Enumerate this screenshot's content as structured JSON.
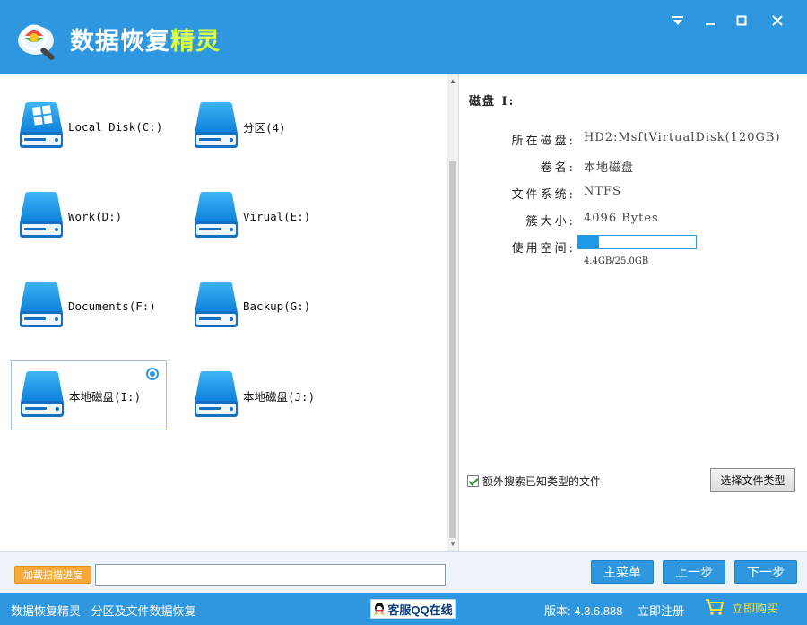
{
  "app": {
    "title_prefix": "数据恢复",
    "title_highlight": "精灵"
  },
  "window_controls": {
    "menu_icon": "menu-down-icon",
    "minimize_icon": "minimize-icon",
    "maximize_icon": "maximize-icon",
    "close_icon": "close-icon"
  },
  "drives": [
    {
      "label": "Local Disk(C:)",
      "icon": "windows-drive-icon",
      "selected": false
    },
    {
      "label": "分区(4)",
      "icon": "drive-icon",
      "selected": false
    },
    {
      "label": "Work(D:)",
      "icon": "drive-icon",
      "selected": false
    },
    {
      "label": "Virual(E:)",
      "icon": "drive-icon",
      "selected": false
    },
    {
      "label": "Documents(F:)",
      "icon": "drive-icon",
      "selected": false
    },
    {
      "label": "Backup(G:)",
      "icon": "drive-icon",
      "selected": false
    },
    {
      "label": "本地磁盘(I:)",
      "icon": "drive-icon",
      "selected": true
    },
    {
      "label": "本地磁盘(J:)",
      "icon": "drive-icon",
      "selected": false
    }
  ],
  "disk_info": {
    "heading": "磁盘 I:",
    "rows": [
      {
        "key": "所在磁盘:",
        "value": "HD2:MsftVirtualDisk(120GB)"
      },
      {
        "key": "卷名:",
        "value": "本地磁盘"
      },
      {
        "key": "文件系统:",
        "value": "NTFS"
      },
      {
        "key": "簇大小:",
        "value": "4096 Bytes"
      },
      {
        "key": "使用空间:",
        "value": ""
      }
    ],
    "usage_fraction": 0.176,
    "usage_text": "4.4GB/25.0GB",
    "extra_search_label": "额外搜索已知类型的文件",
    "extra_search_checked": true,
    "select_type_button": "选择文件类型"
  },
  "bottom": {
    "load_progress_button": "加载扫描进度",
    "main_menu_button": "主菜单",
    "prev_button": "上一步",
    "next_button": "下一步"
  },
  "status": {
    "left_text": "数据恢复精灵 - 分区及文件数据恢复",
    "qq_button": "客服QQ在线",
    "version": "版本: 4.3.6.888",
    "register": "立即注册",
    "buy": "立即购买"
  },
  "colors": {
    "primary": "#2f97e0",
    "accent_title": "#d8ff3a",
    "buy_text": "#ffe23a",
    "load_button": "#f7a93c"
  }
}
